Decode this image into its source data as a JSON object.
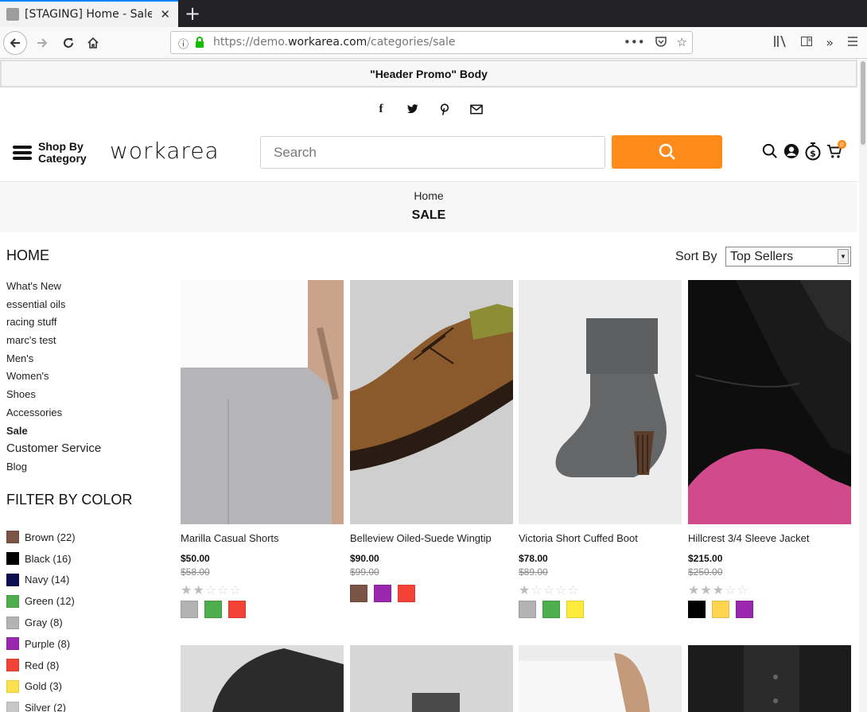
{
  "browser": {
    "tab_title": "[STAGING] Home - Sale - Workarea",
    "url_prefix": "https://demo.",
    "url_domain": "workarea.com",
    "url_path": "/categories/sale"
  },
  "promo": {
    "text": "\"Header Promo\" Body"
  },
  "header": {
    "shop_by_category": "Shop By Category",
    "logo": "workarea",
    "search_placeholder": "Search",
    "cart_count": "0"
  },
  "breadcrumb": {
    "home": "Home",
    "title": "SALE"
  },
  "sidebar": {
    "home_heading": "HOME",
    "links": [
      {
        "label": "What's New"
      },
      {
        "label": "essential oils"
      },
      {
        "label": "racing stuff"
      },
      {
        "label": "marc's test"
      },
      {
        "label": "Men's"
      },
      {
        "label": "Women's"
      },
      {
        "label": "Shoes"
      },
      {
        "label": "Accessories"
      },
      {
        "label": "Sale"
      },
      {
        "label": "Customer Service"
      },
      {
        "label": "Blog"
      }
    ],
    "filter_heading": "FILTER BY COLOR",
    "colors": [
      {
        "label": "Brown (22)",
        "color": "#7b5446"
      },
      {
        "label": "Black (16)",
        "color": "#000000"
      },
      {
        "label": "Navy (14)",
        "color": "#0d1050"
      },
      {
        "label": "Green (12)",
        "color": "#4cae4c"
      },
      {
        "label": "Gray (8)",
        "color": "#b3b3b3"
      },
      {
        "label": "Purple (8)",
        "color": "#9b27af"
      },
      {
        "label": "Red (8)",
        "color": "#f44336"
      },
      {
        "label": "Gold (3)",
        "color": "#ffe14d"
      },
      {
        "label": "Silver (2)",
        "color": "#c7c7c7"
      }
    ]
  },
  "sort": {
    "label": "Sort By",
    "selected": "Top Sellers"
  },
  "products": [
    {
      "name": "Marilla Casual Shorts",
      "price": "$50.00",
      "old_price": "$58.00",
      "rating": 2,
      "swatches": [
        "#b3b3b3",
        "#4cae4c",
        "#f44336"
      ]
    },
    {
      "name": "Belleview Oiled-Suede Wingtip",
      "price": "$90.00",
      "old_price": "$99.00",
      "rating": 0,
      "swatches": [
        "#7b5446",
        "#9b27af",
        "#f44336"
      ]
    },
    {
      "name": "Victoria Short Cuffed Boot",
      "price": "$78.00",
      "old_price": "$89.00",
      "rating": 1,
      "swatches": [
        "#b3b3b3",
        "#4cae4c",
        "#ffeb3b"
      ]
    },
    {
      "name": "Hillcrest 3/4 Sleeve Jacket",
      "price": "$215.00",
      "old_price": "$250.00",
      "rating": 3,
      "swatches": [
        "#000000",
        "#ffd54f",
        "#9b27af"
      ]
    }
  ]
}
